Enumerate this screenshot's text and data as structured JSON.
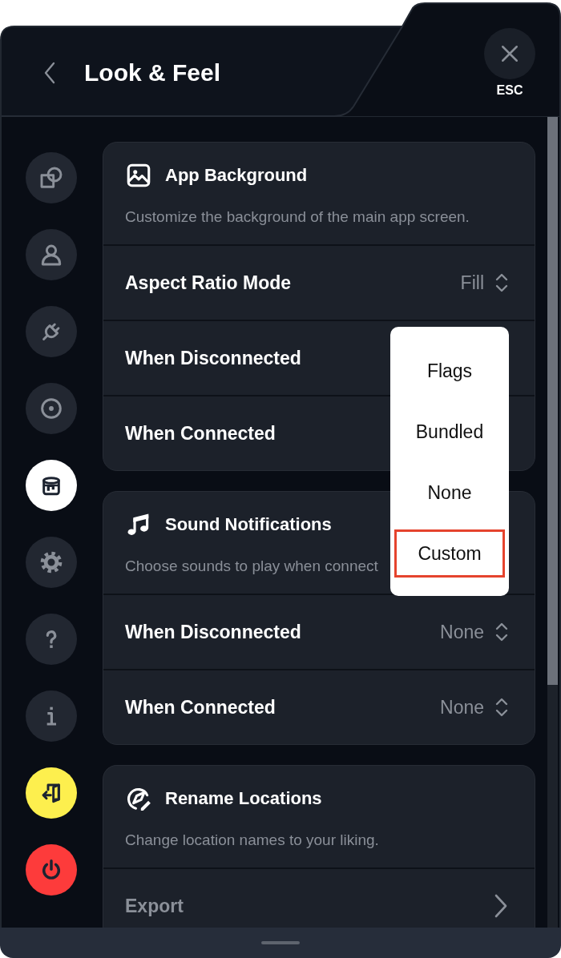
{
  "header": {
    "title": "Look & Feel",
    "close_label": "ESC"
  },
  "sidebar": {
    "items": [
      {
        "kind": "nav",
        "selected": false
      },
      {
        "kind": "nav",
        "selected": false
      },
      {
        "kind": "nav",
        "selected": false
      },
      {
        "kind": "nav",
        "selected": false
      },
      {
        "kind": "nav",
        "selected": true
      },
      {
        "kind": "nav",
        "selected": false
      },
      {
        "kind": "nav",
        "selected": false
      },
      {
        "kind": "nav",
        "selected": false
      },
      {
        "kind": "action",
        "color": "#fdef4e"
      },
      {
        "kind": "action",
        "color": "#fd3b3b"
      }
    ]
  },
  "sections": [
    {
      "title": "App Background",
      "description": "Customize the background of the main app screen.",
      "rows": [
        {
          "kind": "select",
          "label": "Aspect Ratio Mode",
          "value": "Fill",
          "disabled": false
        },
        {
          "kind": "select",
          "label": "When Disconnected",
          "disabled": false
        },
        {
          "kind": "select",
          "label": "When Connected",
          "disabled": false
        }
      ]
    },
    {
      "title": "Sound Notifications",
      "description": "Choose sounds to play when connect",
      "rows": [
        {
          "kind": "select",
          "label": "When Disconnected",
          "value": "None",
          "disabled": false
        },
        {
          "kind": "select",
          "label": "When Connected",
          "value": "None",
          "disabled": false
        }
      ]
    },
    {
      "title": "Rename Locations",
      "description": "Change location names to your liking.",
      "rows": [
        {
          "kind": "link",
          "label": "Export",
          "disabled": true
        }
      ]
    }
  ],
  "dropdown": {
    "options": [
      {
        "label": "Flags",
        "selected": false
      },
      {
        "label": "Bundled",
        "selected": false
      },
      {
        "label": "None",
        "selected": false
      },
      {
        "label": "Custom",
        "selected": true
      }
    ]
  }
}
